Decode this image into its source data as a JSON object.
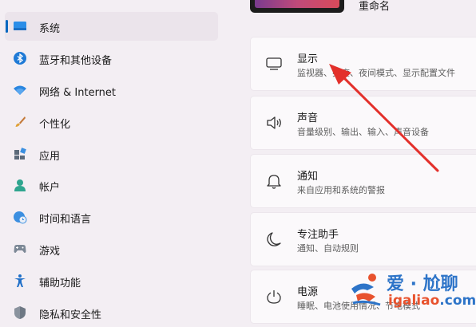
{
  "sidebar": {
    "items": [
      {
        "label": "系统",
        "icon": "monitor-icon",
        "selected": true
      },
      {
        "label": "蓝牙和其他设备",
        "icon": "bluetooth-icon"
      },
      {
        "label": "网络 & Internet",
        "icon": "wifi-icon"
      },
      {
        "label": "个性化",
        "icon": "brush-icon"
      },
      {
        "label": "应用",
        "icon": "apps-icon"
      },
      {
        "label": "帐户",
        "icon": "account-icon"
      },
      {
        "label": "时间和语言",
        "icon": "globe-clock-icon"
      },
      {
        "label": "游戏",
        "icon": "gamepad-icon"
      },
      {
        "label": "辅助功能",
        "icon": "accessibility-icon"
      },
      {
        "label": "隐私和安全性",
        "icon": "shield-icon"
      }
    ]
  },
  "device": {
    "rename_label": "重命名"
  },
  "settings": [
    {
      "title": "显示",
      "desc": "监视器、亮度、夜间模式、显示配置文件",
      "icon": "display-icon"
    },
    {
      "title": "声音",
      "desc": "音量级别、输出、输入、声音设备",
      "icon": "speaker-icon"
    },
    {
      "title": "通知",
      "desc": "来自应用和系统的警报",
      "icon": "bell-icon"
    },
    {
      "title": "专注助手",
      "desc": "通知、自动规则",
      "icon": "moon-icon"
    },
    {
      "title": "电源",
      "desc": "睡眠、电池使用情况、节电模式",
      "icon": "power-icon"
    }
  ],
  "watermark": {
    "brand": "爱 · 尬聊",
    "url_part1": "igaliao",
    "url_part2": ".com"
  },
  "colors": {
    "accent": "#0067c0",
    "arrow": "#e3302b"
  }
}
